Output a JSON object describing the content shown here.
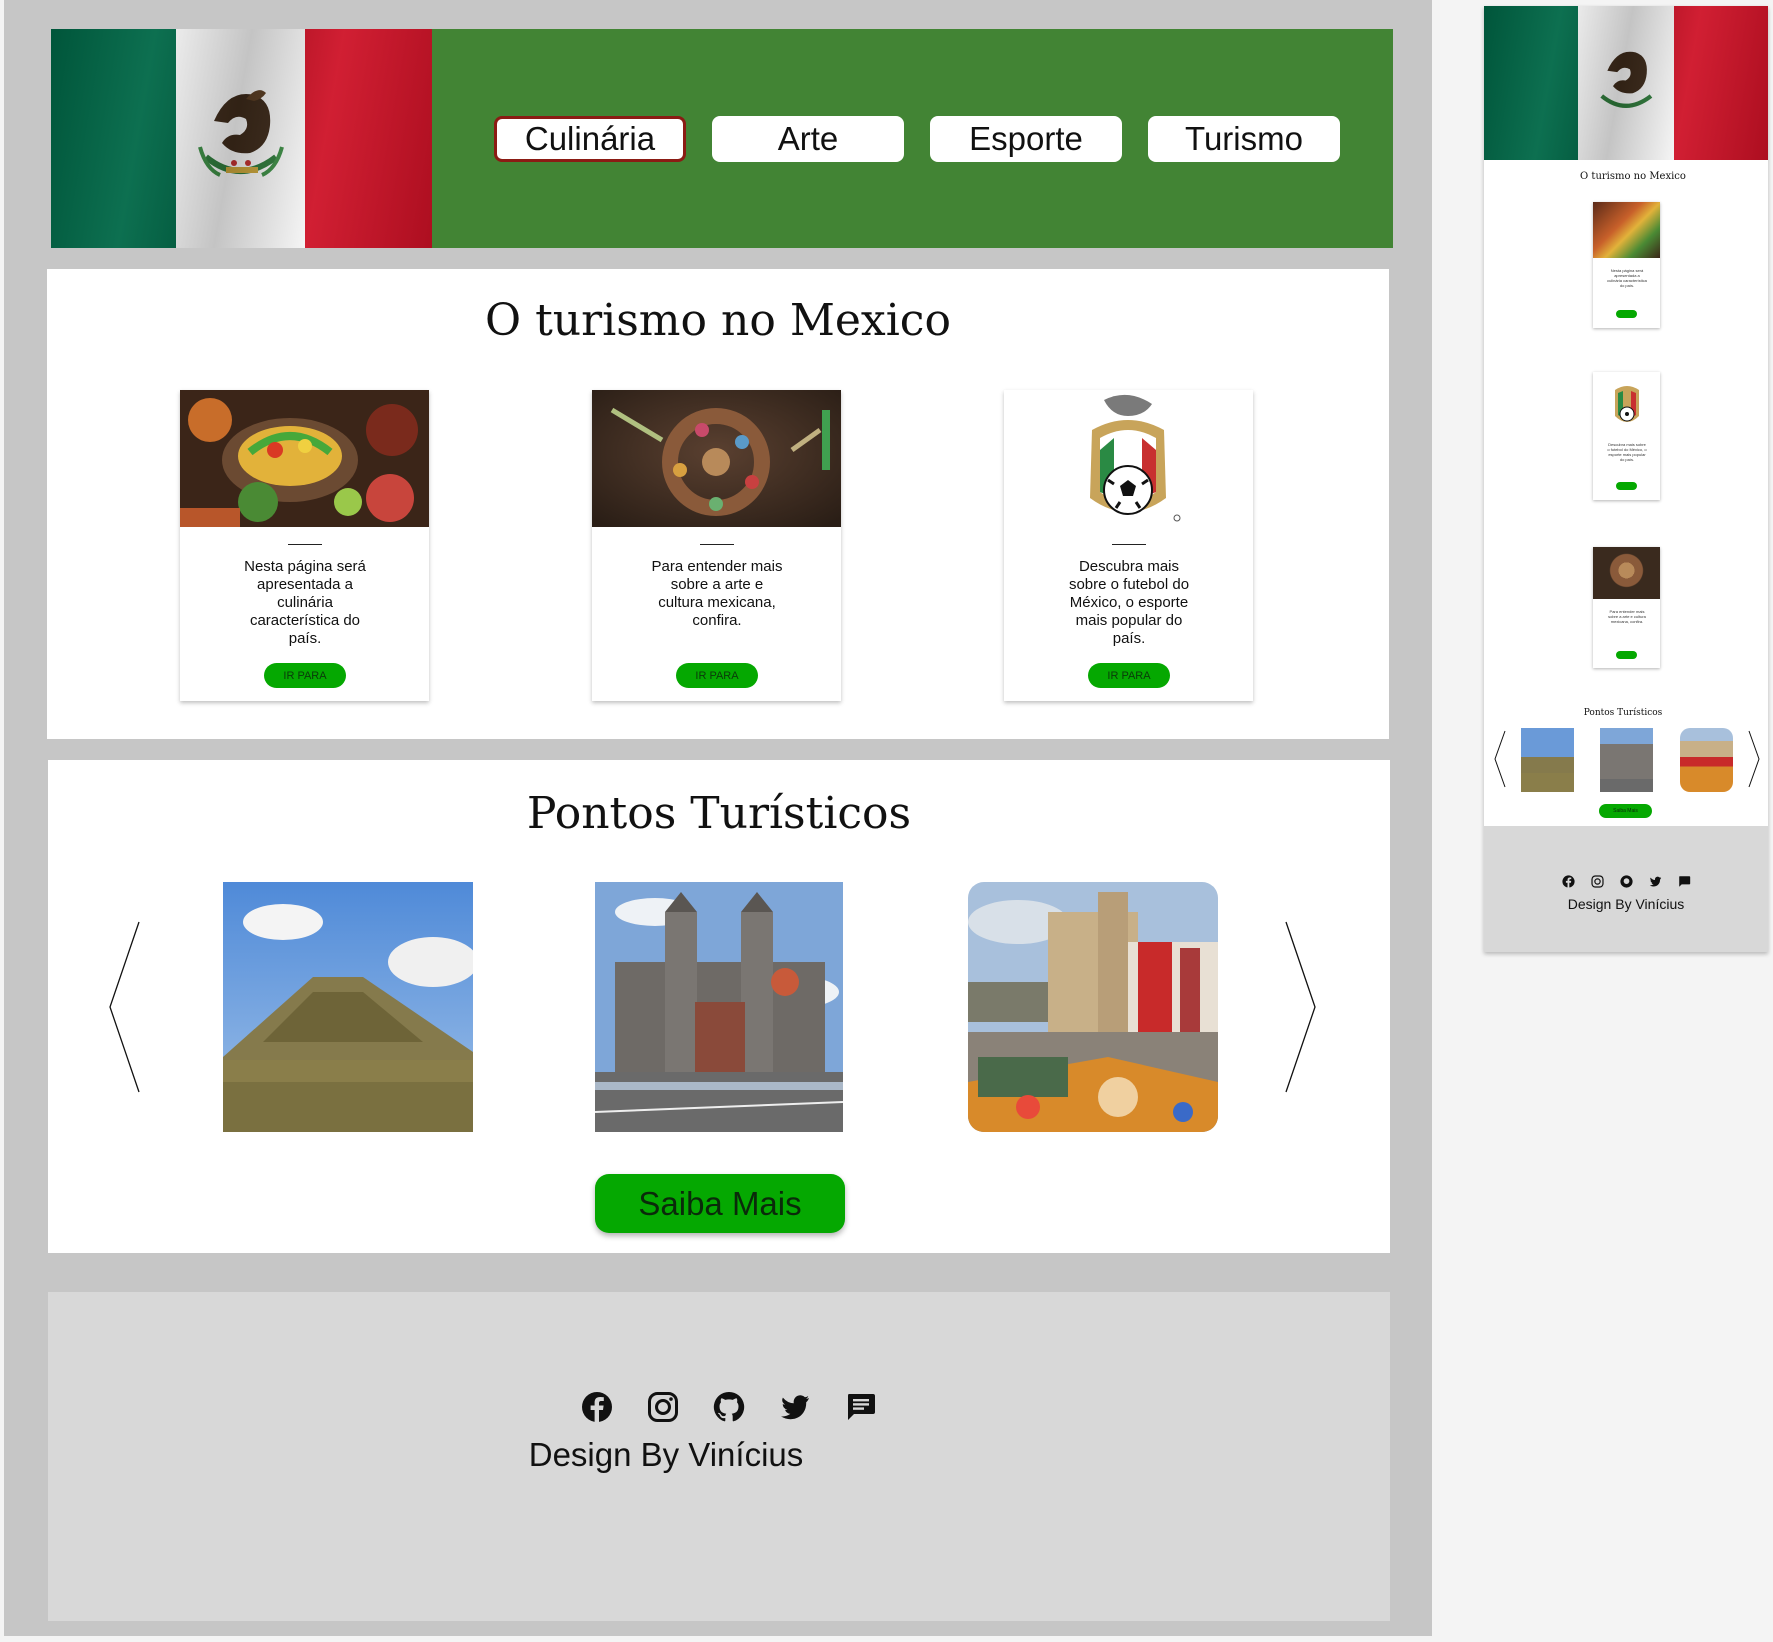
{
  "nav": {
    "items": [
      {
        "label": "Culinária",
        "active": true
      },
      {
        "label": "Arte",
        "active": false
      },
      {
        "label": "Esporte",
        "active": false
      },
      {
        "label": "Turismo",
        "active": false
      }
    ]
  },
  "tourism_section": {
    "title": "O turismo no Mexico",
    "cards": [
      {
        "image": "food-photo",
        "text": "Nesta página será apresentada a culinária característica do país.",
        "button": "IR PARA"
      },
      {
        "image": "art-photo",
        "text": "Para entender mais sobre a arte e cultura mexicana, confira.",
        "button": "IR PARA"
      },
      {
        "image": "football-crest",
        "text": "Descubra mais sobre o futebol do México, o esporte mais popular do país.",
        "button": "IR PARA"
      }
    ]
  },
  "points_section": {
    "title": "Pontos Turísticos",
    "photos": [
      "pyramid-photo",
      "cathedral-photo",
      "church-square-photo"
    ],
    "prev_icon": "chevron-left-icon",
    "next_icon": "chevron-right-icon",
    "more_button": "Saiba Mais"
  },
  "footer": {
    "icons": [
      "facebook-icon",
      "instagram-icon",
      "github-icon",
      "twitter-icon",
      "message-icon"
    ],
    "credit": "Design By Vinícius"
  },
  "mobile": {
    "title": "O turismo no Mexico",
    "points_title": "Pontos Turísticos",
    "card_texts": [
      "Nesta página será apresentada a culinária característica do país.",
      "Descubra mais sobre o futebol do México, o esporte mais popular do país.",
      "Para entender mais sobre a arte e cultura mexicana, confira."
    ],
    "more_button": "Saiba Mais",
    "credit": "Design By Vinícius"
  },
  "colors": {
    "header_green": "#428434",
    "button_green": "#05a801",
    "active_border": "#8b1b14",
    "flag_green": "#006847",
    "flag_red": "#ce1126",
    "frame_gray": "#c6c6c6",
    "footer_gray": "#d8d8d8"
  }
}
